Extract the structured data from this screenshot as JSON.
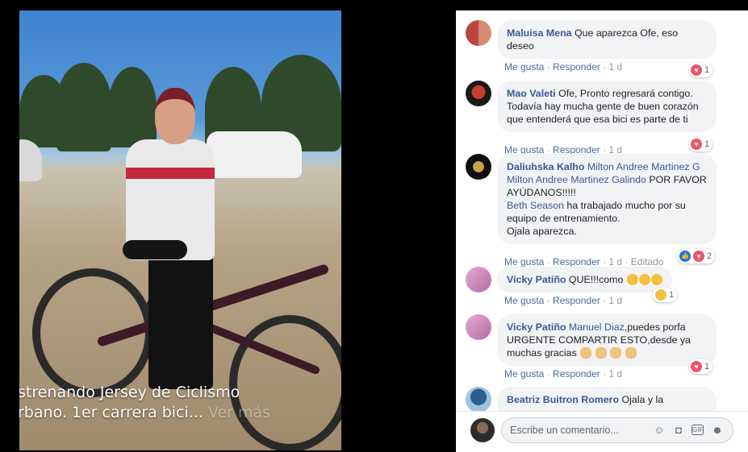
{
  "photo": {
    "caption_line1": "strenando Jersey de Ciclismo",
    "caption_line2": "rbano. 1er carrera bici...",
    "caption_more": "Ver más"
  },
  "comments": [
    {
      "author": "Maluisa Mena",
      "text": "Que aparezca Ofe, eso deseo",
      "like": "Me gusta",
      "reply": "Responder",
      "time": "1 d",
      "reactions": "1"
    },
    {
      "author": "Mao Valeti",
      "text": "Ofe, Pronto regresará contigo. Todavía hay mucha gente de buen corazón que entenderá que esa bici es parte de ti",
      "like": "Me gusta",
      "reply": "Responder",
      "time": "1 d",
      "reactions": "1"
    },
    {
      "author": "Daliuhska Kalho",
      "mention1": "Milton Andree Martinez G",
      "mention1b": "Milton Andree Martinez Galindo",
      "text1": "POR FAVOR AYÚDANOS!!!!!",
      "mention2": "Beth Season",
      "text2": "ha trabajado mucho por su equipo de entrenamiento.",
      "text3": "Ojala aparezca.",
      "like": "Me gusta",
      "reply": "Responder",
      "time": "1 d",
      "edited": "Editado",
      "reactions": "2"
    },
    {
      "author": "Vicky Patiño",
      "text": "QUE!!!como",
      "like": "Me gusta",
      "reply": "Responder",
      "time": "1 d",
      "reactions": "1"
    },
    {
      "author": "Vicky Patiño",
      "mention": "Manuel Diaz",
      "text": ",puedes porfa URGENTE COMPARTIR ESTO,desde ya muchas gracias",
      "like": "Me gusta",
      "reply": "Responder",
      "time": "1 d",
      "reactions": "1"
    },
    {
      "author": "Beatriz Buitron Romero",
      "text": "Ojala y la"
    }
  ],
  "composer": {
    "placeholder": "Escribe un comentario..."
  },
  "colors": {
    "link": "#385898",
    "heart": "#f25268",
    "like": "#1877f2",
    "bubble": "#f2f3f5"
  }
}
